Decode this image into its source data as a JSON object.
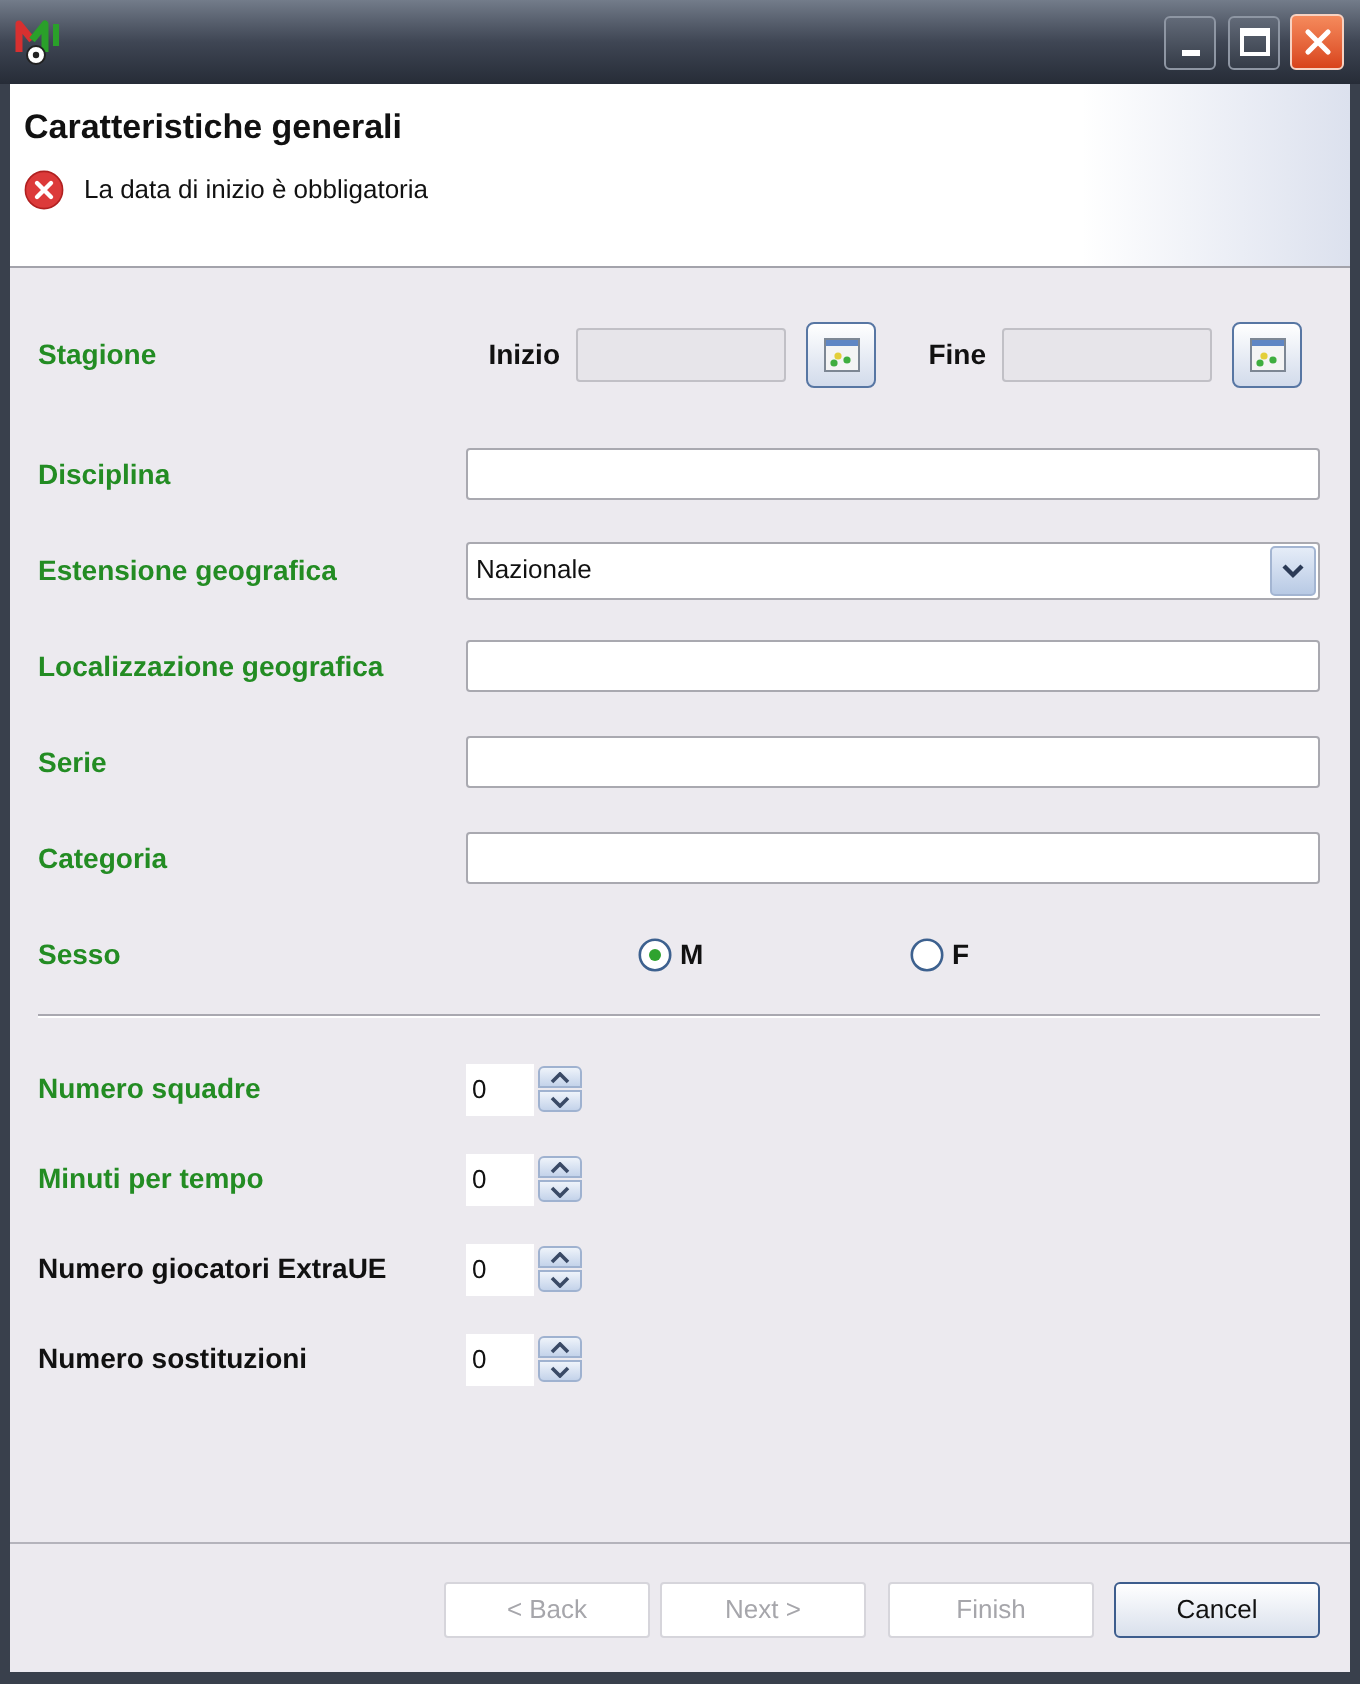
{
  "header": {
    "title": "Caratteristiche generali",
    "message": {
      "kind": "error",
      "text": "La data di inizio è obbligatoria"
    }
  },
  "fields": [
    {
      "kind": "date_range",
      "label": "Stagione",
      "required": true,
      "parts": [
        {
          "label": "Inizio",
          "disabled": true
        },
        {
          "label": "Fine",
          "disabled": true
        }
      ]
    },
    {
      "kind": "text",
      "label": "Disciplina",
      "required": true
    },
    {
      "kind": "combo",
      "label": "Estensione geografica",
      "required": true,
      "value": "Nazionale"
    },
    {
      "kind": "text",
      "label": "Localizzazione geografica",
      "required": true
    },
    {
      "kind": "text",
      "label": "Serie",
      "required": true
    },
    {
      "kind": "text",
      "label": "Categoria",
      "required": true
    },
    {
      "kind": "radio",
      "label": "Sesso",
      "required": true,
      "options": [
        {
          "label": "M",
          "selected": true
        },
        {
          "label": "F",
          "selected": false
        }
      ]
    }
  ],
  "counters": [
    {
      "label": "Numero squadre",
      "required": true,
      "value": "0"
    },
    {
      "label": "Minuti per tempo",
      "required": true,
      "value": "0"
    },
    {
      "label": "Numero giocatori ExtraUE",
      "required": false,
      "value": "0"
    },
    {
      "label": "Numero sostituzioni",
      "required": false,
      "value": "0"
    }
  ],
  "buttons": [
    {
      "label": "< Back",
      "disabled": true
    },
    {
      "label": "Next >",
      "disabled": true
    },
    {
      "label": "Finish",
      "disabled": true
    },
    {
      "label": "Cancel",
      "disabled": false
    }
  ]
}
